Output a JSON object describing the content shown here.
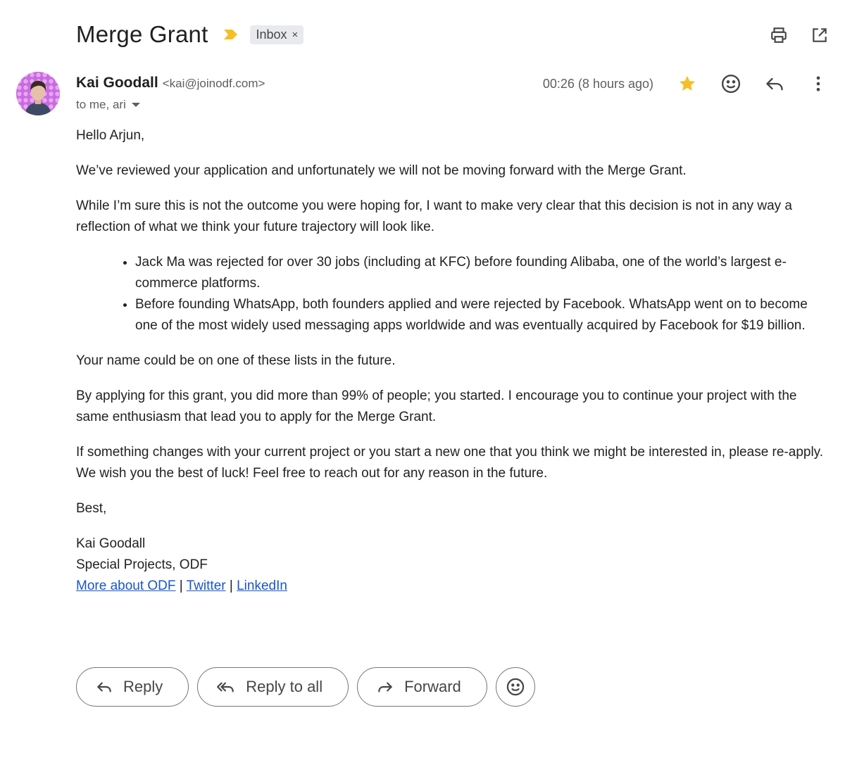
{
  "subject": "Merge Grant",
  "label": {
    "name": "Inbox",
    "remove": "×"
  },
  "sender": {
    "name": "Kai Goodall",
    "email": "<kai@joinodf.com>"
  },
  "recipients": "to me, ari",
  "timestamp": "00:26 (8 hours ago)",
  "body": {
    "greeting": "Hello Arjun,",
    "p1": "We’ve reviewed your application and unfortunately we will not be moving forward with the Merge Grant.",
    "p2": "While I’m sure this is not the outcome you were hoping for, I want to make very clear that this decision is not in any way a reflection of what we think your future trajectory will look like.",
    "bullets": [
      "Jack Ma was rejected for over 30 jobs (including at KFC) before founding Alibaba, one of the world’s largest e-commerce platforms.",
      "Before founding WhatsApp, both founders applied and were rejected by Facebook. WhatsApp went on to become one of the most widely used messaging apps worldwide and was eventually acquired by Facebook for $19 billion."
    ],
    "p3": "Your name could be on one of these lists in the future.",
    "p4": "By applying for this grant, you did more than 99% of people; you started. I encourage you to continue your project with the same enthusiasm that lead you to apply for the Merge Grant.",
    "p5": "If something changes with your current project or you start a new one that you think we might be interested in, please re-apply. We wish you the best of luck! Feel free to reach out for any reason in the future.",
    "closing": "Best,"
  },
  "signature": {
    "name": "Kai Goodall",
    "title": "Special Projects, ODF",
    "links": [
      "More about ODF",
      "Twitter",
      "LinkedIn"
    ],
    "separator": "|"
  },
  "actions": {
    "reply": "Reply",
    "reply_all": "Reply to all",
    "forward": "Forward"
  },
  "icons": {
    "important": "importance-marker-icon",
    "print": "print-icon",
    "open_new": "open-in-new-window-icon",
    "star": "star-icon",
    "emoji": "emoji-reaction-icon",
    "reply": "reply-icon",
    "more": "more-vert-icon"
  },
  "colors": {
    "star": "#f6bf26",
    "important": "#f6bf26",
    "link": "#1a56c8",
    "chip_bg": "#e8eaed"
  }
}
